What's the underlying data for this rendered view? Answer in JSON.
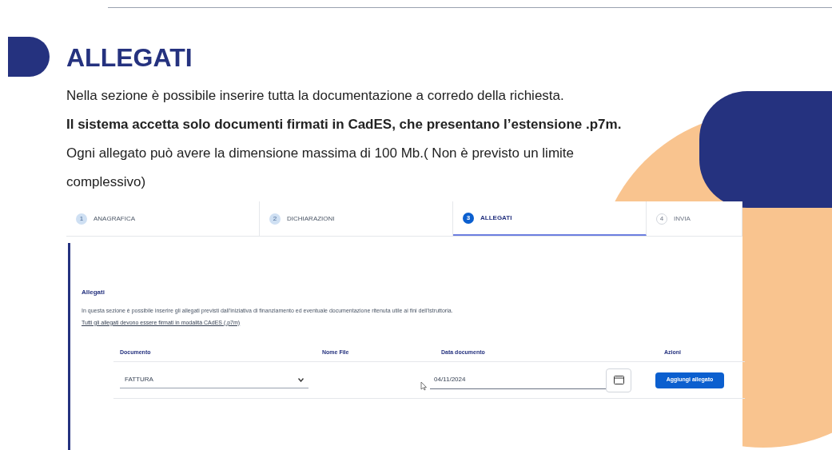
{
  "title": "ALLEGATI",
  "paragraphs": [
    {
      "text": "Nella sezione è possibile inserire tutta la documentazione a corredo della richiesta.",
      "bold": false
    },
    {
      "text": "Il sistema accetta solo documenti firmati in CadES, che presentano l’estensione .p7m.",
      "bold": true
    },
    {
      "text": "Ogni allegato può avere la dimensione massima di 100 Mb.( Non è previsto un limite complessivo)",
      "bold": false
    }
  ],
  "steps": [
    {
      "number": "1",
      "label": "ANAGRAFICA",
      "selected": false,
      "disabled": false
    },
    {
      "number": "2",
      "label": "DICHIARAZIONI",
      "selected": false,
      "disabled": false
    },
    {
      "number": "3",
      "label": "ALLEGATI",
      "selected": true,
      "disabled": false
    },
    {
      "number": "4",
      "label": "INVIA",
      "selected": false,
      "disabled": true
    }
  ],
  "section": {
    "heading": "Allegati",
    "description": "In questa sezione è possibile inserire gli allegati previsti dall'iniziativa di finanziamento ed eventuale documentazione ritenuta utile ai fini dell'istruttoria.",
    "note": "Tutti gli allegati devono essere firmati in modalità CAdES (.p7m)"
  },
  "table": {
    "columns": [
      "Documento",
      "Nome File",
      "Data documento",
      "Azioni"
    ],
    "row": {
      "document": "FATTURA",
      "date": "04/11/2024",
      "action": "Aggiungi allegato"
    }
  }
}
